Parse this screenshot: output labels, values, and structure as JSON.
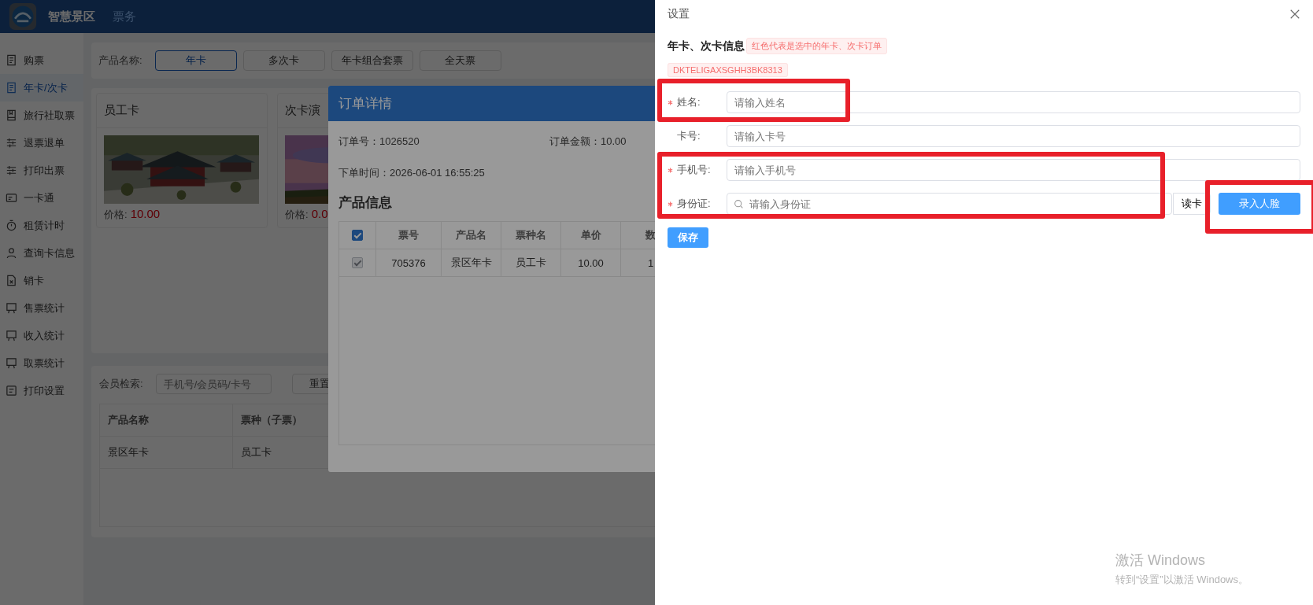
{
  "header": {
    "app_name": "智慧景区",
    "nav": "票务"
  },
  "sidebar": {
    "items": [
      {
        "label": "购票",
        "selected": false
      },
      {
        "label": "年卡/次卡",
        "selected": true
      },
      {
        "label": "旅行社取票",
        "selected": false
      },
      {
        "label": "退票退单",
        "selected": false
      },
      {
        "label": "打印出票",
        "selected": false
      },
      {
        "label": "一卡通",
        "selected": false
      },
      {
        "label": "租赁计时",
        "selected": false
      },
      {
        "label": "查询卡信息",
        "selected": false
      },
      {
        "label": "销卡",
        "selected": false
      },
      {
        "label": "售票统计",
        "selected": false
      },
      {
        "label": "收入统计",
        "selected": false
      },
      {
        "label": "取票统计",
        "selected": false
      },
      {
        "label": "打印设置",
        "selected": false
      }
    ]
  },
  "product_filter": {
    "label": "产品名称:",
    "options": [
      {
        "label": "年卡",
        "selected": true
      },
      {
        "label": "多次卡",
        "selected": false
      },
      {
        "label": "年卡组合套票",
        "selected": false
      },
      {
        "label": "全天票",
        "selected": false
      }
    ]
  },
  "cards": [
    {
      "title": "员工卡",
      "price_label": "价格:",
      "price": "10.00",
      "kind": "picture"
    },
    {
      "title": "次卡演",
      "price_label": "价格:",
      "price": "0.0",
      "kind": "picture"
    }
  ],
  "member_search": {
    "label": "会员检索:",
    "placeholder": "手机号/会员码/卡号",
    "reset": "重置",
    "columns": [
      "产品名称",
      "票种（子票）"
    ],
    "rows": [
      [
        "景区年卡",
        "员工卡"
      ]
    ]
  },
  "order_modal": {
    "title": "订单详情",
    "order_no": "订单号：1026520",
    "amount": "订单金额：10.00",
    "time": "下单时间：2026-06-01 16:55:25",
    "section": "产品信息",
    "table": {
      "all_checked": true,
      "columns": [
        "票号",
        "产品名",
        "票种名",
        "单价",
        "数"
      ],
      "rows": [
        {
          "checked": true,
          "disabled": true,
          "cells": [
            "705376",
            "景区年卡",
            "员工卡",
            "10.00",
            "1"
          ]
        }
      ]
    }
  },
  "drawer": {
    "title": "设置",
    "heading": "年卡、次卡信息",
    "hint_tag": "红色代表是选中的年卡、次卡订单",
    "card_tag": "DKTELIGAXSGHH3BK8313",
    "fields": [
      {
        "label": "姓名:",
        "required": true,
        "placeholder": "请输入姓名",
        "kind": "text"
      },
      {
        "label": "卡号:",
        "required": false,
        "placeholder": "请输入卡号",
        "kind": "text"
      },
      {
        "label": "手机号:",
        "required": true,
        "placeholder": "请输入手机号",
        "kind": "text"
      },
      {
        "label": "身份证:",
        "required": true,
        "placeholder": "请输入身份证",
        "kind": "search",
        "read_button": "读卡",
        "face_button": "录入人脸"
      }
    ],
    "save": "保存"
  },
  "system_notice": {
    "title": "激活 Windows",
    "text": "转到“设置”以激活 Windows。"
  }
}
